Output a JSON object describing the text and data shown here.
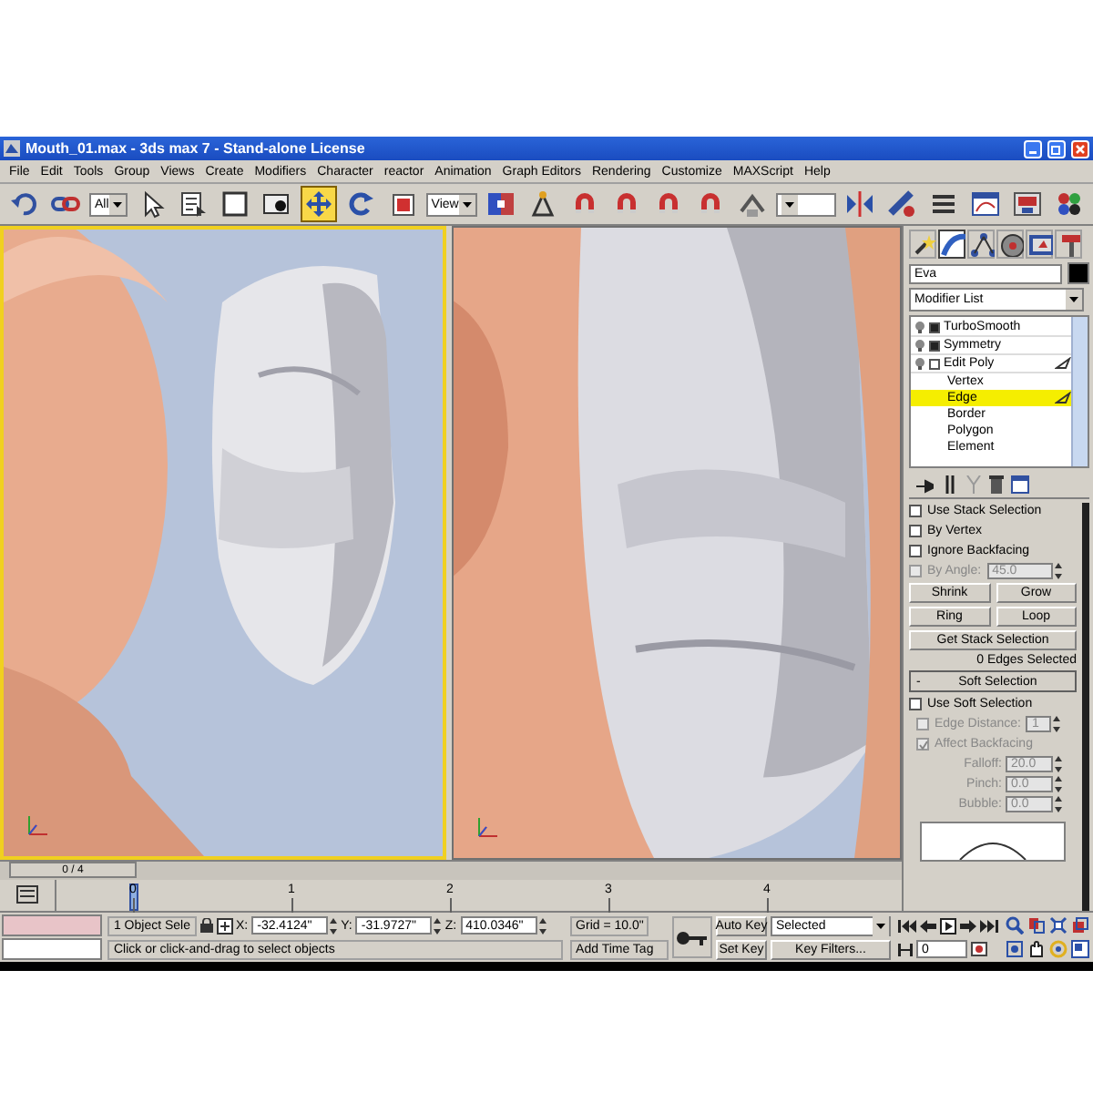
{
  "window": {
    "title": "Mouth_01.max - 3ds max 7  - Stand-alone License"
  },
  "menu": [
    "File",
    "Edit",
    "Tools",
    "Group",
    "Views",
    "Create",
    "Modifiers",
    "Character",
    "reactor",
    "Animation",
    "Graph Editors",
    "Rendering",
    "Customize",
    "MAXScript",
    "Help"
  ],
  "toolbar": [
    {
      "kind": "undo",
      "selected": false
    },
    {
      "kind": "link",
      "selected": false
    },
    {
      "kind": "dropdown",
      "value": "All"
    },
    {
      "kind": "select",
      "selected": false
    },
    {
      "kind": "select_by_name",
      "selected": false
    },
    {
      "kind": "region",
      "selected": false
    },
    {
      "kind": "crossing",
      "selected": false
    },
    {
      "kind": "move",
      "selected": true
    },
    {
      "kind": "rotate",
      "selected": false
    },
    {
      "kind": "scale",
      "selected": false
    },
    {
      "kind": "dropdown",
      "value": "View"
    },
    {
      "kind": "pivot",
      "selected": false
    },
    {
      "kind": "manipulate",
      "selected": false
    },
    {
      "kind": "snap",
      "selected": false
    },
    {
      "kind": "snap",
      "selected": false
    },
    {
      "kind": "snap",
      "selected": false
    },
    {
      "kind": "snap",
      "selected": false
    },
    {
      "kind": "named_selection",
      "selected": false
    },
    {
      "kind": "dropdown"
    },
    {
      "kind": "mirror",
      "selected": false
    },
    {
      "kind": "align",
      "selected": false
    },
    {
      "kind": "layers",
      "selected": false
    },
    {
      "kind": "curve_editor",
      "selected": false
    },
    {
      "kind": "render_scene",
      "selected": false
    },
    {
      "kind": "quick_render",
      "selected": false
    }
  ],
  "viewports": [
    {
      "kind": "picture",
      "active": true
    },
    {
      "kind": "picture",
      "active": false
    }
  ],
  "command_panel": {
    "tabs": [
      {
        "kind": "create",
        "selected": false
      },
      {
        "kind": "modify",
        "selected": true
      },
      {
        "kind": "hierarchy",
        "selected": false
      },
      {
        "kind": "motion",
        "selected": false
      },
      {
        "kind": "display",
        "selected": false
      },
      {
        "kind": "utilities",
        "selected": false
      }
    ],
    "object_name": "Eva",
    "modifier_list": "Modifier List",
    "stack": [
      {
        "label": "TurboSmooth",
        "expanded": false,
        "selected": false
      },
      {
        "label": "Symmetry",
        "expanded": false,
        "selected": false
      },
      {
        "label": "Edit Poly",
        "expanded": true,
        "selected": false,
        "children": [
          {
            "label": "Vertex",
            "selected": false
          },
          {
            "label": "Edge",
            "selected": true
          },
          {
            "label": "Border",
            "selected": false
          },
          {
            "label": "Polygon",
            "selected": false
          },
          {
            "label": "Element",
            "selected": false
          }
        ]
      }
    ],
    "selection": {
      "checkboxes": [
        {
          "label": "Use Stack Selection",
          "checked": false
        },
        {
          "label": "By Vertex",
          "checked": false
        },
        {
          "label": "Ignore Backfacing",
          "checked": false
        }
      ],
      "by_angle": {
        "label": "By Angle:",
        "value": "45.0",
        "checked": false,
        "disabled": true
      },
      "button_rows": [
        [
          "Shrink",
          "Grow"
        ],
        [
          "Ring",
          "Loop"
        ],
        [
          "Get Stack Selection"
        ]
      ],
      "status": "0 Edges Selected"
    },
    "soft_selection": {
      "collapse": "-",
      "title": "Soft Selection",
      "use_soft": {
        "label": "Use Soft Selection",
        "checked": false
      },
      "edge_distance": {
        "label": "Edge Distance:",
        "value": "1",
        "checked": false,
        "disabled": true
      },
      "affect_backfacing": {
        "label": "Affect Backfacing",
        "checked": true,
        "disabled": true
      },
      "params": [
        {
          "label": "Falloff:",
          "value": "20.0"
        },
        {
          "label": "Pinch:",
          "value": "0.0"
        },
        {
          "label": "Bubble:",
          "value": "0.0"
        }
      ],
      "params_disabled": true
    }
  },
  "time_slider": {
    "label": "0 / 4",
    "level": 0
  },
  "track_bar": {
    "ticks": [
      "0",
      "1",
      "2",
      "3",
      "4"
    ]
  },
  "status_bar": {
    "selection": "1 Object Sele",
    "coords": [
      {
        "axis": "X:",
        "value": "-32.4124\""
      },
      {
        "axis": "Y:",
        "value": "-31.9727\""
      },
      {
        "axis": "Z:",
        "value": "410.0346\""
      }
    ],
    "grid": "Grid = 10.0\"",
    "prompt": "Click or click-and-drag to select objects",
    "add_time_tag": "Add Time Tag",
    "auto_key": "Auto Key",
    "key_mode": "Selected",
    "set_key": "Set Key",
    "key_filters": "Key Filters...",
    "frame": "0"
  }
}
